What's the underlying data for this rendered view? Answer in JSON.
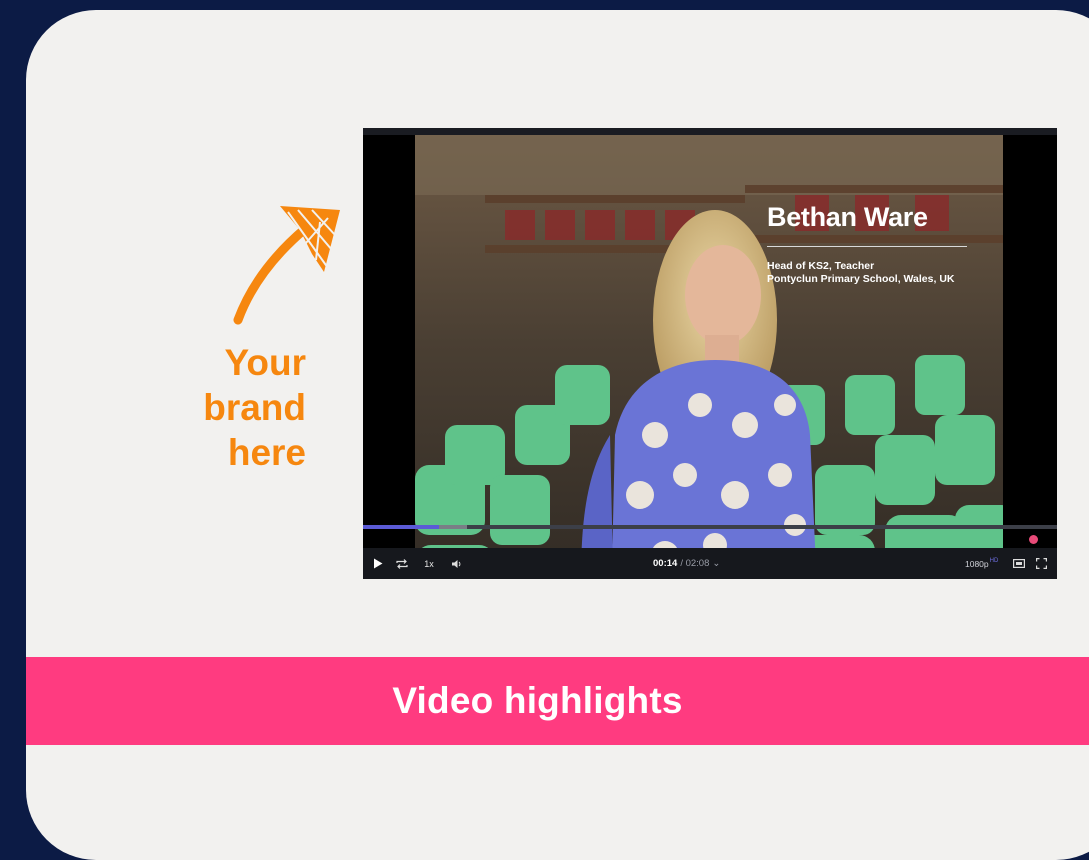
{
  "promo": {
    "lines": [
      "Your",
      "brand",
      "here"
    ],
    "accent_color": "#f6870f",
    "arrow_icon": "hand-drawn-arrow"
  },
  "video": {
    "overlay": {
      "name": "Bethan Ware",
      "role_line1": "Head of KS2, Teacher",
      "role_line2": "Pontyclun Primary School, Wales, UK"
    },
    "progress_fraction": 0.11,
    "buffered_fraction": 0.15,
    "controls": {
      "play_icon": "play-icon",
      "loop_icon": "loop-icon",
      "speed_label": "1x",
      "volume_icon": "volume-icon",
      "current_time": "00:14",
      "duration": "/ 02:08",
      "duration_caret": "⌄",
      "quality_label": "1080p",
      "quality_badge": "HD",
      "theater_icon": "theater-mode-icon",
      "fullscreen_icon": "fullscreen-icon"
    }
  },
  "banner": {
    "title": "Video highlights",
    "color": "#ff3b80"
  },
  "colors": {
    "background": "#0c1b45",
    "card": "#f2f1ef",
    "progress": "#5b5bd6"
  }
}
